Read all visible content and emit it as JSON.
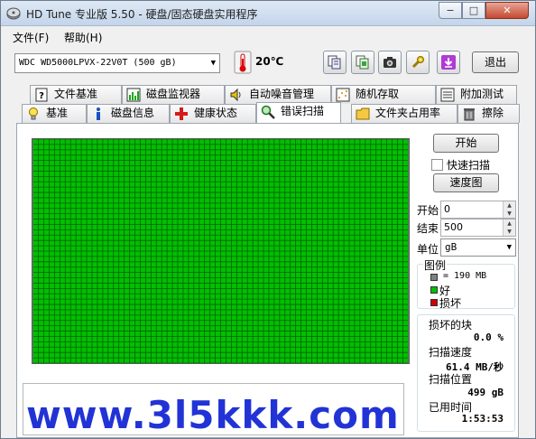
{
  "window": {
    "title": "HD Tune 专业版 5.50 - 硬盘/固态硬盘实用程序",
    "min_label": "−",
    "max_label": "□",
    "close_label": "✕"
  },
  "menu": [
    {
      "label": "文件(F)"
    },
    {
      "label": "帮助(H)"
    }
  ],
  "toolbar": {
    "drive": "WDC WD5000LPVX-22V0T (500 gB)",
    "temperature": "20℃",
    "exit_label": "退出",
    "icons": [
      "copy-info-icon",
      "copy-screen-icon",
      "camera-icon",
      "options-icon",
      "save-icon"
    ]
  },
  "tabs_top": [
    {
      "label": "文件基准",
      "icon": "file-benchmark-icon"
    },
    {
      "label": "磁盘监视器",
      "icon": "disk-monitor-icon"
    },
    {
      "label": "自动噪音管理",
      "icon": "speaker-icon"
    },
    {
      "label": "随机存取",
      "icon": "random-access-icon"
    },
    {
      "label": "附加测试",
      "icon": "extra-tests-icon"
    }
  ],
  "tabs_bottom": [
    {
      "label": "基准",
      "icon": "benchmark-icon"
    },
    {
      "label": "磁盘信息",
      "icon": "info-icon"
    },
    {
      "label": "健康状态",
      "icon": "health-icon"
    },
    {
      "label": "错误扫描",
      "icon": "error-scan-icon",
      "active": true
    },
    {
      "label": "文件夹占用率",
      "icon": "folder-icon"
    },
    {
      "label": "擦除",
      "icon": "trash-icon"
    }
  ],
  "scan": {
    "start_button": "开始",
    "quick_scan_label": "快速扫描",
    "quick_scan_checked": false,
    "map_button": "速度图",
    "start_label": "开始",
    "start_value": "0",
    "end_label": "结束",
    "end_value": "500",
    "unit_label": "单位",
    "unit_value": "gB",
    "block_state": "good"
  },
  "legend": {
    "title": "图例",
    "block_size": "= 190 MB",
    "good_label": "好",
    "bad_label": "损坏",
    "colors": {
      "block": "#808080",
      "good": "#00c000",
      "bad": "#d00000"
    }
  },
  "stats": {
    "damaged_label": "损坏的块",
    "damaged_value": "0.0 %",
    "speed_label": "扫描速度",
    "speed_value": "61.4 MB/秒",
    "position_label": "扫描位置",
    "position_value": "499 gB",
    "elapsed_label": "已用时间",
    "elapsed_value": "1:53:53"
  },
  "watermark": "www.3l5kkk.com"
}
